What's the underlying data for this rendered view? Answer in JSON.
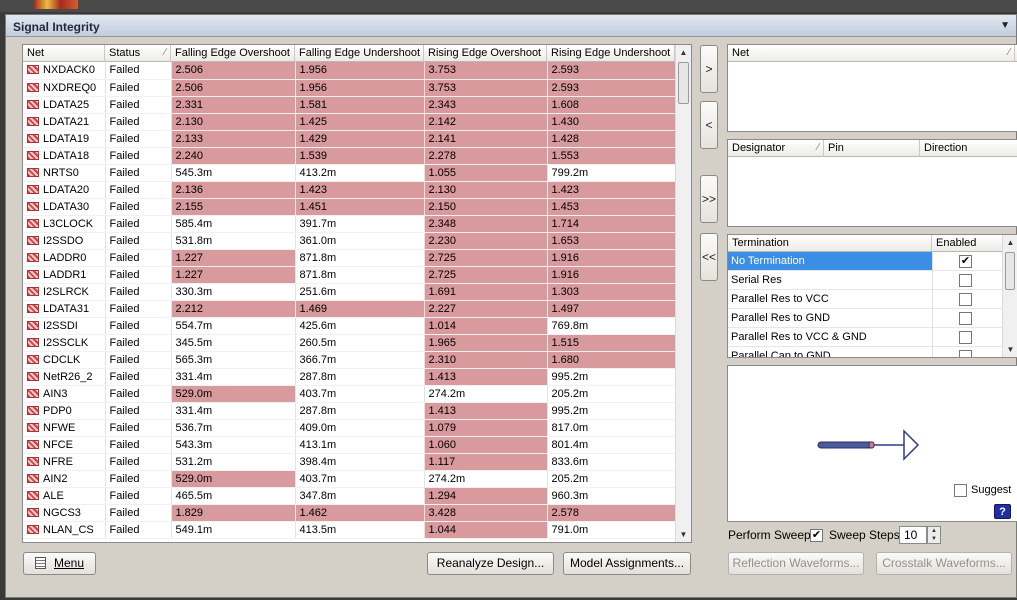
{
  "window": {
    "title": "Signal Integrity"
  },
  "net_table": {
    "columns": [
      "Net",
      "Status",
      "Falling Edge Overshoot",
      "Falling Edge Undershoot",
      "Rising Edge Overshoot",
      "Rising Edge Undershoot"
    ],
    "rows": [
      {
        "net": "NXDACK0",
        "status": "Failed",
        "feo": "2.506",
        "feu": "1.956",
        "reo": "3.753",
        "reu": "2.593",
        "fail": [
          1,
          1,
          1,
          1
        ]
      },
      {
        "net": "NXDREQ0",
        "status": "Failed",
        "feo": "2.506",
        "feu": "1.956",
        "reo": "3.753",
        "reu": "2.593",
        "fail": [
          1,
          1,
          1,
          1
        ]
      },
      {
        "net": "LDATA25",
        "status": "Failed",
        "feo": "2.331",
        "feu": "1.581",
        "reo": "2.343",
        "reu": "1.608",
        "fail": [
          1,
          1,
          1,
          1
        ]
      },
      {
        "net": "LDATA21",
        "status": "Failed",
        "feo": "2.130",
        "feu": "1.425",
        "reo": "2.142",
        "reu": "1.430",
        "fail": [
          1,
          1,
          1,
          1
        ]
      },
      {
        "net": "LDATA19",
        "status": "Failed",
        "feo": "2.133",
        "feu": "1.429",
        "reo": "2.141",
        "reu": "1.428",
        "fail": [
          1,
          1,
          1,
          1
        ]
      },
      {
        "net": "LDATA18",
        "status": "Failed",
        "feo": "2.240",
        "feu": "1.539",
        "reo": "2.278",
        "reu": "1.553",
        "fail": [
          1,
          1,
          1,
          1
        ]
      },
      {
        "net": "NRTS0",
        "status": "Failed",
        "feo": "545.3m",
        "feu": "413.2m",
        "reo": "1.055",
        "reu": "799.2m",
        "fail": [
          0,
          0,
          1,
          0
        ]
      },
      {
        "net": "LDATA20",
        "status": "Failed",
        "feo": "2.136",
        "feu": "1.423",
        "reo": "2.130",
        "reu": "1.423",
        "fail": [
          1,
          1,
          1,
          1
        ]
      },
      {
        "net": "LDATA30",
        "status": "Failed",
        "feo": "2.155",
        "feu": "1.451",
        "reo": "2.150",
        "reu": "1.453",
        "fail": [
          1,
          1,
          1,
          1
        ]
      },
      {
        "net": "L3CLOCK",
        "status": "Failed",
        "feo": "585.4m",
        "feu": "391.7m",
        "reo": "2.348",
        "reu": "1.714",
        "fail": [
          0,
          0,
          1,
          1
        ]
      },
      {
        "net": "I2SSDO",
        "status": "Failed",
        "feo": "531.8m",
        "feu": "361.0m",
        "reo": "2.230",
        "reu": "1.653",
        "fail": [
          0,
          0,
          1,
          1
        ]
      },
      {
        "net": "LADDR0",
        "status": "Failed",
        "feo": "1.227",
        "feu": "871.8m",
        "reo": "2.725",
        "reu": "1.916",
        "fail": [
          1,
          0,
          1,
          1
        ]
      },
      {
        "net": "LADDR1",
        "status": "Failed",
        "feo": "1.227",
        "feu": "871.8m",
        "reo": "2.725",
        "reu": "1.916",
        "fail": [
          1,
          0,
          1,
          1
        ]
      },
      {
        "net": "I2SLRCK",
        "status": "Failed",
        "feo": "330.3m",
        "feu": "251.6m",
        "reo": "1.691",
        "reu": "1.303",
        "fail": [
          0,
          0,
          1,
          1
        ]
      },
      {
        "net": "LDATA31",
        "status": "Failed",
        "feo": "2.212",
        "feu": "1.469",
        "reo": "2.227",
        "reu": "1.497",
        "fail": [
          1,
          1,
          1,
          1
        ]
      },
      {
        "net": "I2SSDI",
        "status": "Failed",
        "feo": "554.7m",
        "feu": "425.6m",
        "reo": "1.014",
        "reu": "769.8m",
        "fail": [
          0,
          0,
          1,
          0
        ]
      },
      {
        "net": "I2SSCLK",
        "status": "Failed",
        "feo": "345.5m",
        "feu": "260.5m",
        "reo": "1.965",
        "reu": "1.515",
        "fail": [
          0,
          0,
          1,
          1
        ]
      },
      {
        "net": "CDCLK",
        "status": "Failed",
        "feo": "565.3m",
        "feu": "366.7m",
        "reo": "2.310",
        "reu": "1.680",
        "fail": [
          0,
          0,
          1,
          1
        ]
      },
      {
        "net": "NetR26_2",
        "status": "Failed",
        "feo": "331.4m",
        "feu": "287.8m",
        "reo": "1.413",
        "reu": "995.2m",
        "fail": [
          0,
          0,
          1,
          0
        ]
      },
      {
        "net": "AIN3",
        "status": "Failed",
        "feo": "529.0m",
        "feu": "403.7m",
        "reo": "274.2m",
        "reu": "205.2m",
        "fail": [
          1,
          0,
          0,
          0
        ]
      },
      {
        "net": "PDP0",
        "status": "Failed",
        "feo": "331.4m",
        "feu": "287.8m",
        "reo": "1.413",
        "reu": "995.2m",
        "fail": [
          0,
          0,
          1,
          0
        ]
      },
      {
        "net": "NFWE",
        "status": "Failed",
        "feo": "536.7m",
        "feu": "409.0m",
        "reo": "1.079",
        "reu": "817.0m",
        "fail": [
          0,
          0,
          1,
          0
        ]
      },
      {
        "net": "NFCE",
        "status": "Failed",
        "feo": "543.3m",
        "feu": "413.1m",
        "reo": "1.060",
        "reu": "801.4m",
        "fail": [
          0,
          0,
          1,
          0
        ]
      },
      {
        "net": "NFRE",
        "status": "Failed",
        "feo": "531.2m",
        "feu": "398.4m",
        "reo": "1.117",
        "reu": "833.6m",
        "fail": [
          0,
          0,
          1,
          0
        ]
      },
      {
        "net": "AIN2",
        "status": "Failed",
        "feo": "529.0m",
        "feu": "403.7m",
        "reo": "274.2m",
        "reu": "205.2m",
        "fail": [
          1,
          0,
          0,
          0
        ]
      },
      {
        "net": "ALE",
        "status": "Failed",
        "feo": "465.5m",
        "feu": "347.8m",
        "reo": "1.294",
        "reu": "960.3m",
        "fail": [
          0,
          0,
          1,
          0
        ]
      },
      {
        "net": "NGCS3",
        "status": "Failed",
        "feo": "1.829",
        "feu": "1.462",
        "reo": "3.428",
        "reu": "2.578",
        "fail": [
          1,
          1,
          1,
          1
        ]
      },
      {
        "net": "NLAN_CS",
        "status": "Failed",
        "feo": "549.1m",
        "feu": "413.5m",
        "reo": "1.044",
        "reu": "791.0m",
        "fail": [
          0,
          0,
          1,
          0
        ]
      }
    ]
  },
  "transfer_buttons": {
    "add": ">",
    "remove": "<",
    "add_all": ">>",
    "remove_all": "<<"
  },
  "net_list": {
    "column": "Net"
  },
  "pin_table": {
    "columns": [
      "Designator",
      "Pin",
      "Direction"
    ]
  },
  "termination": {
    "columns": [
      "Termination",
      "Enabled"
    ],
    "items": [
      {
        "label": "No Termination",
        "checked": true,
        "selected": true
      },
      {
        "label": "Serial Res",
        "checked": false,
        "selected": false
      },
      {
        "label": "Parallel Res to VCC",
        "checked": false,
        "selected": false
      },
      {
        "label": "Parallel Res to GND",
        "checked": false,
        "selected": false
      },
      {
        "label": "Parallel Res to VCC & GND",
        "checked": false,
        "selected": false
      },
      {
        "label": "Parallel Cap to GND",
        "checked": false,
        "selected": false
      }
    ]
  },
  "preview": {
    "suggest_label": "Suggest",
    "suggest_checked": false,
    "help": "?"
  },
  "sweep": {
    "perform_label": "Perform Sweep",
    "perform_checked": true,
    "steps_label": "Sweep Steps:",
    "steps_value": "10"
  },
  "buttons": {
    "menu": "Menu",
    "reanalyze": "Reanalyze Design...",
    "model": "Model Assignments...",
    "reflection": "Reflection Waveforms...",
    "crosstalk": "Crosstalk Waveforms..."
  },
  "colors": {
    "fail": "#d99a9e",
    "selection": "#3a8ee6"
  }
}
